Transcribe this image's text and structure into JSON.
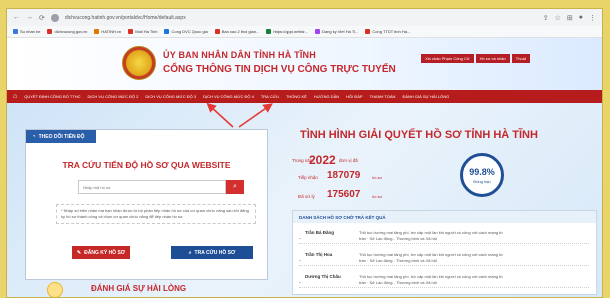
{
  "browser": {
    "url": "dichvucong.hatinh.gov.vn/portaldvc/Home/default.aspx",
    "bookmarks": [
      {
        "label": "Su nhan he",
        "color": "#3c78d8"
      },
      {
        "label": "dichvucong.gov.vn",
        "color": "#d93025"
      },
      {
        "label": "HATINH.vn",
        "color": "#e37400"
      },
      {
        "label": "Mail Ha Tinh",
        "color": "#d93025"
      },
      {
        "label": "Cong DVC Quoc gia",
        "color": "#1a73e8"
      },
      {
        "label": "Bao cao 2 thoi gian...",
        "color": "#d93025"
      },
      {
        "label": "https://qppl.netbiz...",
        "color": "#188038"
      },
      {
        "label": "Dang ky Viet Ha Ti...",
        "color": "#a142f4"
      },
      {
        "label": "Cong TTDT tinh Ha...",
        "color": "#d93025"
      }
    ]
  },
  "header": {
    "title_line1": "ỦY BAN NHÂN DÂN TỈNH HÀ TĨNH",
    "title_line2": "CỔNG THÔNG TIN DỊCH VỤ CÔNG TRỰC TUYẾN",
    "buttons": [
      "Xin chào Phạm Công Cử",
      "Hồ sơ cá nhân",
      "Thoát"
    ]
  },
  "nav": {
    "items": [
      "QUYẾT ĐỊNH CÔNG BỐ TTHC",
      "DỊCH VỤ CÔNG MỨC ĐỘ 2",
      "DỊCH VỤ CÔNG MỨC ĐỘ 3",
      "DỊCH VỤ CÔNG MỨC ĐỘ 4",
      "TRA CỨU",
      "THỐNG KÊ",
      "HƯỚNG DẪN",
      "HỎI ĐÁP",
      "THANH TOÁN",
      "ĐÁNH GIÁ SỰ HÀI LÒNG"
    ]
  },
  "search_card": {
    "tab_label": "THEO DÕI TIẾN ĐỘ",
    "title": "TRA CỨU TIẾN ĐỘ HỒ SƠ QUA WEBSITE",
    "input_placeholder": "Nhập mã hồ sơ",
    "note": "* Nhập số biên nhận mà bạn nhận được từ bộ phận tiếp nhận hồ sơ của cơ quan chức năng sau khi đăng ký hồ sơ thành công và chọn cơ quan chức năng để tiếp nhận hồ sơ",
    "register_button": "ĐĂNG KÝ HỒ SƠ",
    "lookup_button": "TRA CỨU HỒ SƠ",
    "survey_text": "ĐÁNH GIÁ SỰ HÀI LÒNG"
  },
  "stats": {
    "title": "TÌNH HÌNH GIẢI QUYẾT HỒ SƠ TỈNH HÀ TĨNH",
    "year_label": "Trong năm",
    "year": "2022",
    "year_suffix": "đơn vị đã",
    "received_label": "Tiếp nhận",
    "received_value": "187079",
    "received_unit": "hồ sơ",
    "processed_label": "Đã xử lý",
    "processed_value": "175607",
    "processed_unit": "hồ sơ",
    "ontime_value": "99.8%",
    "ontime_label": "Đúng hạn"
  },
  "results_list": {
    "heading": "DANH SÁCH HỒ SƠ CHỜ TRẢ KẾT QUẢ",
    "rows": [
      {
        "name": "Trần Bá Đăng",
        "desc": "Thủ tục hướng mai tăng phí, trợ cấp một lần khi người có công với cách mạng từ trần · Sở Lao động - Thương binh và Xã hội"
      },
      {
        "name": "Trần Thị Hoa",
        "desc": "Thủ tục hướng mai tăng phí, trợ cấp một lần khi người có công với cách mạng từ trần · Sở Lao động - Thương binh và Xã hội"
      },
      {
        "name": "Dương Thị Châu",
        "desc": "Thủ tục hướng mai tăng phí, trợ cấp một lần khi người có công với cách mạng từ trần · Sở Lao động - Thương binh và Xã hội"
      }
    ]
  },
  "colors": {
    "brand_red": "#b71c1c",
    "title_red": "#c4282c",
    "primary_blue": "#1e4f96",
    "frame_yellow": "#e9d46a"
  }
}
